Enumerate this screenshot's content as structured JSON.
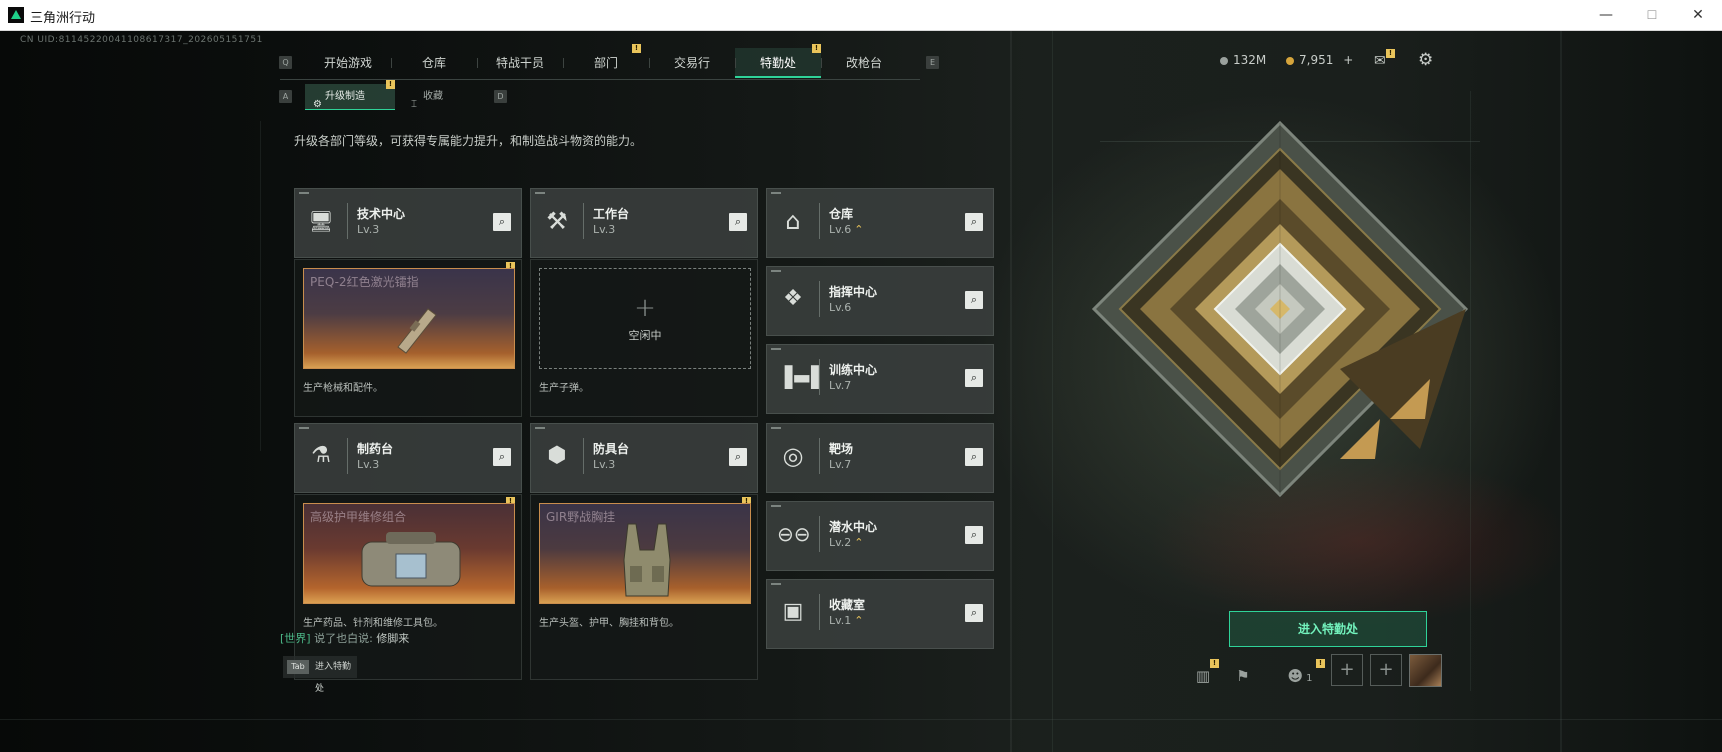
{
  "window": {
    "title": "三角洲行动",
    "minimize": "—",
    "maximize": "☐",
    "close": "✕"
  },
  "uid": "CN UID:81145220041108617317_202605151751",
  "nav": {
    "key_left": "Q",
    "key_right": "E",
    "tabs": [
      "开始游戏",
      "仓库",
      "特战干员",
      "部门",
      "交易行",
      "特勤处",
      "改枪台"
    ],
    "active": "特勤处",
    "badge": "!"
  },
  "subnav": {
    "key_left": "A",
    "key_right": "D",
    "tabs": [
      "升级制造",
      "收藏"
    ],
    "active": "升级制造"
  },
  "resources": {
    "currency1": "132M",
    "currency2": "7,951",
    "plus": "+"
  },
  "description": "升级各部门等级，可获得专属能力提升，和制造战斗物资的能力。",
  "facilities": {
    "tech_center": {
      "name": "技术中心",
      "level": "Lv.3"
    },
    "workbench": {
      "name": "工作台",
      "level": "Lv.3"
    },
    "warehouse": {
      "name": "仓库",
      "level": "Lv.6",
      "upgradable": "⌃"
    },
    "command_center": {
      "name": "指挥中心",
      "level": "Lv.6"
    },
    "training_center": {
      "name": "训练中心",
      "level": "Lv.7"
    },
    "pharmacy": {
      "name": "制药台",
      "level": "Lv.3"
    },
    "armor_bench": {
      "name": "防具台",
      "level": "Lv.3"
    },
    "shooting_range": {
      "name": "靶场",
      "level": "Lv.7"
    },
    "diving_center": {
      "name": "潜水中心",
      "level": "Lv.2",
      "upgradable": "⌃"
    },
    "collection_room": {
      "name": "收藏室",
      "level": "Lv.1",
      "upgradable": "⌃"
    }
  },
  "production": {
    "tech_center": {
      "item": "PEQ-2红色激光镭指",
      "desc": "生产枪械和配件。"
    },
    "workbench": {
      "idle_plus": "+",
      "idle_label": "空闲中",
      "desc": "生产子弹。"
    },
    "pharmacy": {
      "item": "高级护甲维修组合",
      "desc": "生产药品、针剂和维修工具包。"
    },
    "armor_bench": {
      "item": "GIR野战胸挂",
      "desc": "生产头盔、护甲、胸挂和背包。"
    }
  },
  "enter_button": "进入特勤处",
  "chat": {
    "channel": "[世界]",
    "sender": "说了也白说",
    "separator": ":",
    "message": "修脚来"
  },
  "tab_hint": {
    "key": "Tab",
    "label": "进入特勤处"
  },
  "bottom_bar": {
    "squad_count": "1"
  },
  "colors": {
    "accent": "#2fd399",
    "badge": "#e9c45b"
  }
}
